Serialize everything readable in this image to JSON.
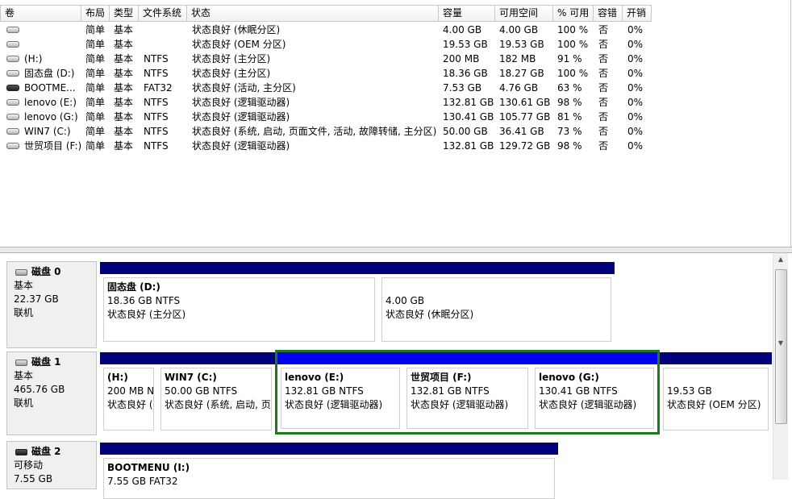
{
  "volume_table": {
    "columns": [
      "卷",
      "布局",
      "类型",
      "文件系统",
      "状态",
      "容量",
      "可用空间",
      "% 可用",
      "容错",
      "开销"
    ],
    "rows": [
      {
        "volume": "",
        "layout": "简单",
        "type": "基本",
        "fs": "",
        "status": "状态良好 (休眠分区)",
        "capacity": "4.00 GB",
        "free": "4.00 GB",
        "pct": "100 %",
        "fault": "否",
        "overhead": "0%",
        "icon": "hard-drive-icon"
      },
      {
        "volume": "",
        "layout": "简单",
        "type": "基本",
        "fs": "",
        "status": "状态良好 (OEM 分区)",
        "capacity": "19.53 GB",
        "free": "19.53 GB",
        "pct": "100 %",
        "fault": "否",
        "overhead": "0%",
        "icon": "hard-drive-icon"
      },
      {
        "volume": "(H:)",
        "layout": "简单",
        "type": "基本",
        "fs": "NTFS",
        "status": "状态良好 (主分区)",
        "capacity": "200 MB",
        "free": "182 MB",
        "pct": "91 %",
        "fault": "否",
        "overhead": "0%",
        "icon": "hard-drive-icon"
      },
      {
        "volume": "固态盘 (D:)",
        "layout": "简单",
        "type": "基本",
        "fs": "NTFS",
        "status": "状态良好 (主分区)",
        "capacity": "18.36 GB",
        "free": "18.27 GB",
        "pct": "100 %",
        "fault": "否",
        "overhead": "0%",
        "icon": "hard-drive-icon"
      },
      {
        "volume": "BOOTME...",
        "layout": "简单",
        "type": "基本",
        "fs": "FAT32",
        "status": "状态良好 (活动, 主分区)",
        "capacity": "7.53 GB",
        "free": "4.76 GB",
        "pct": "63 %",
        "fault": "否",
        "overhead": "0%",
        "icon": "removable-drive-icon"
      },
      {
        "volume": "lenovo (E:)",
        "layout": "简单",
        "type": "基本",
        "fs": "NTFS",
        "status": "状态良好 (逻辑驱动器)",
        "capacity": "132.81 GB",
        "free": "130.61 GB",
        "pct": "98 %",
        "fault": "否",
        "overhead": "0%",
        "icon": "hard-drive-icon"
      },
      {
        "volume": "lenovo (G:)",
        "layout": "简单",
        "type": "基本",
        "fs": "NTFS",
        "status": "状态良好 (逻辑驱动器)",
        "capacity": "130.41 GB",
        "free": "105.77 GB",
        "pct": "81 %",
        "fault": "否",
        "overhead": "0%",
        "icon": "hard-drive-icon"
      },
      {
        "volume": "WIN7 (C:)",
        "layout": "简单",
        "type": "基本",
        "fs": "NTFS",
        "status": "状态良好 (系统, 启动, 页面文件, 活动, 故障转储, 主分区)",
        "capacity": "50.00 GB",
        "free": "36.41 GB",
        "pct": "73 %",
        "fault": "否",
        "overhead": "0%",
        "icon": "hard-drive-icon"
      },
      {
        "volume": "世贸项目 (F:)",
        "layout": "简单",
        "type": "基本",
        "fs": "NTFS",
        "status": "状态良好 (逻辑驱动器)",
        "capacity": "132.81 GB",
        "free": "129.72 GB",
        "pct": "98 %",
        "fault": "否",
        "overhead": "0%",
        "icon": "hard-drive-icon"
      }
    ]
  },
  "disks": [
    {
      "title": "磁盘 0",
      "type": "基本",
      "size": "22.37 GB",
      "state": "联机",
      "icon": "hard-disk-icon",
      "partitions": [
        {
          "name": "固态盘  (D:)",
          "size": "18.36 GB NTFS",
          "status": "状态良好 (主分区)",
          "kind": "primary"
        },
        {
          "name": "",
          "size": "4.00 GB",
          "status": "状态良好 (休眠分区)",
          "kind": "primary"
        }
      ]
    },
    {
      "title": "磁盘 1",
      "type": "基本",
      "size": "465.76 GB",
      "state": "联机",
      "icon": "hard-disk-icon",
      "partitions": [
        {
          "name": "(H:)",
          "size": "200 MB N",
          "status": "状态良好 (",
          "kind": "primary"
        },
        {
          "name": "WIN7  (C:)",
          "size": "50.00 GB NTFS",
          "status": "状态良好 (系统, 启动, 页",
          "kind": "primary"
        },
        {
          "name": "lenovo  (E:)",
          "size": "132.81 GB NTFS",
          "status": "状态良好 (逻辑驱动器)",
          "kind": "logical"
        },
        {
          "name": "世贸项目  (F:)",
          "size": "132.81 GB NTFS",
          "status": "状态良好 (逻辑驱动器)",
          "kind": "logical"
        },
        {
          "name": "lenovo  (G:)",
          "size": "130.41 GB NTFS",
          "status": "状态良好 (逻辑驱动器)",
          "kind": "logical"
        },
        {
          "name": "",
          "size": "19.53 GB",
          "status": "状态良好 (OEM 分区)",
          "kind": "primary"
        }
      ]
    },
    {
      "title": "磁盘 2",
      "type": "可移动",
      "size": "7.55 GB",
      "state": "",
      "icon": "removable-disk-icon",
      "partitions": [
        {
          "name": "BOOTMENU  (I:)",
          "size": "7.55 GB FAT32",
          "status": "",
          "kind": "primary"
        }
      ]
    }
  ],
  "colors": {
    "primary_bar": "#00007a",
    "logical_bar": "#0000f0",
    "extended_frame": "#1f7a1f"
  }
}
